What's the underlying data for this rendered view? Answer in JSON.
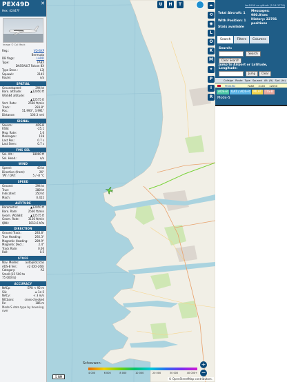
{
  "aircraft": {
    "callsign": "PEX49D",
    "hex_label": "Hex:",
    "hex": "42447F",
    "photo_caption": "Image © Col Mack",
    "close_icon": "close-icon",
    "general": [
      {
        "label": "Reg.:",
        "value": "VQ-BXP",
        "link": true
      },
      {
        "label": "",
        "value": "Bermuda",
        "link": false
      },
      {
        "label": "DB flags:",
        "value": "LADD",
        "link": true
      },
      {
        "label": "Type:",
        "value": "FA8X",
        "link": false
      },
      {
        "label": "",
        "value": "DASSAULT Falcon 8X",
        "link": false
      },
      {
        "label": "Type Desc.:",
        "value": "L3J",
        "link": false
      },
      {
        "label": "Squawk:",
        "value": "2145",
        "link": false
      },
      {
        "label": "Route:",
        "value": "n/a",
        "link": false
      }
    ],
    "sections": [
      {
        "title": "SPATIAL",
        "rows": [
          {
            "label": "Groundspeed:",
            "value": "294 kt"
          },
          {
            "label": "Baro. altitude:",
            "value": "▲12050 ft"
          },
          {
            "label": "WGS84 altitude:",
            "value": ""
          },
          {
            "label": "",
            "value": "▲12575 ft"
          },
          {
            "label": "Vert. Rate:",
            "value": "2560 ft/min"
          },
          {
            "label": "Track:",
            "value": "283.8°"
          },
          {
            "label": "Pos.:",
            "value": "51.993°, 3.991°"
          },
          {
            "label": "Distance:",
            "value": "100.3 nmi"
          }
        ]
      },
      {
        "title": "SIGNAL",
        "rows": [
          {
            "label": "Source:",
            "value": "ADS-B"
          },
          {
            "label": "RSSI:",
            "value": "-25.1"
          },
          {
            "label": "Msg. Rate:",
            "value": "1.6"
          },
          {
            "label": "Messages:",
            "value": "158"
          },
          {
            "label": "Last Pos.:",
            "value": "0.7 s"
          },
          {
            "label": "Last Seen:",
            "value": "0.7 s"
          }
        ]
      },
      {
        "title": "FMS SEL",
        "rows": [
          {
            "label": "Sel. Alt.:",
            "value": "18000 ft"
          },
          {
            "label": "Sel. Head.:",
            "value": "n/a"
          }
        ]
      },
      {
        "title": "WIND",
        "rows": [
          {
            "label": "Speed:",
            "value": "43 kt"
          },
          {
            "label": "Direction (from):",
            "value": "26°"
          },
          {
            "label": "TAT / OAT:",
            "value": "5 / -8 °C"
          }
        ]
      },
      {
        "title": "SPEED",
        "rows": [
          {
            "label": "Ground:",
            "value": "294 kt"
          },
          {
            "label": "True:",
            "value": "288 kt"
          },
          {
            "label": "Indicated:",
            "value": "250 kt"
          },
          {
            "label": "Mach:",
            "value": "0.452"
          }
        ]
      },
      {
        "title": "ALTITUDE",
        "rows": [
          {
            "label": "Barometric:",
            "value": "▲12050 ft"
          },
          {
            "label": "Baro. Rate:",
            "value": "2560 ft/min"
          },
          {
            "label": "Geom. WGS84:",
            "value": "▲12575 ft"
          },
          {
            "label": "Geom. Rate:",
            "value": "3136 ft/min"
          },
          {
            "label": "QNH:",
            "value": "1013.6 hPa"
          }
        ]
      },
      {
        "title": "DIRECTION",
        "rows": [
          {
            "label": "Ground Track:",
            "value": "283.8°"
          },
          {
            "label": "True Heading:",
            "value": "292.3°"
          },
          {
            "label": "Magnetic Heading:",
            "value": "289.9°"
          },
          {
            "label": "Magnetic Decl.:",
            "value": "2.4°"
          },
          {
            "label": "Track Rate:",
            "value": "0.06"
          },
          {
            "label": "Roll:",
            "value": "0.5"
          }
        ]
      },
      {
        "title": "STUFF",
        "rows": [
          {
            "label": "Nav. Modes:",
            "value": "autopilot,tcas"
          },
          {
            "label": "ADS-B Ver.:",
            "value": "v2 (DO-260)"
          },
          {
            "label": "Category:",
            "value": "A2"
          },
          {
            "label": "Small (15 500 to",
            "value": ""
          },
          {
            "label": "75 000 lb)",
            "value": ""
          }
        ]
      },
      {
        "title": "ACCURACY",
        "rows": [
          {
            "label": "NACp:",
            "value": "EPU < 92 m"
          },
          {
            "label": "SIL:",
            "value": "≤ 1e-5"
          },
          {
            "label": "NACv:",
            "value": "< 3 m/s"
          },
          {
            "label": "NICbaro:",
            "value": "cross-checked"
          },
          {
            "label": "Rc:",
            "value": "186 m"
          }
        ]
      }
    ],
    "footer_note": "Mode S data type by hovering over"
  },
  "map": {
    "top_buttons": [
      "U",
      "H",
      "T"
    ],
    "side_buttons": [
      "L",
      "O",
      "K",
      "M",
      "P",
      "I",
      "R"
    ],
    "scale_label": "5 NM",
    "place_label": "Schouwen-",
    "attribution": "© OpenStreetMap contributors.",
    "alt_labels": [
      "4 000",
      "6 000",
      "8 000",
      "10 000",
      "20 000",
      "30 000",
      "40 000+"
    ],
    "zoom_in": "+",
    "zoom_out": "−"
  },
  "panel": {
    "github_link": "tar1090 on github (3.14.1779)",
    "total_label": "Total Aircraft: 1",
    "messages_label": "Messages:",
    "messages_value": "980.8/sec",
    "with_position": "With Position: 1",
    "history_label": "History: 22781",
    "history_sub": "positions",
    "stats_label": "Stats available",
    "tabs": [
      "Search",
      "Filters",
      "Columns"
    ],
    "search_label": "Search:",
    "search_button": "Search",
    "clear_search": "Clear Search",
    "jump_label": "Jump to Airport or Latitude, Longitude:",
    "jump_button": "Jump",
    "clear_button": "Clear",
    "columns": [
      "Callsign",
      "Route",
      "Type",
      "Squawk",
      "Alt. (ft)",
      "Spd. (kt)"
    ],
    "row": {
      "callsign": "PEX49D",
      "type": "FA8X",
      "squawk": "2145",
      "alt": "12050"
    },
    "badges": [
      {
        "text": "ADS-B",
        "color": "#4cc8a6"
      },
      {
        "text": "UAT / ADS-R",
        "color": "#5ab4e6"
      },
      {
        "text": "MLAT",
        "color": "#f0d44a"
      },
      {
        "text": "TIS-B",
        "color": "#e7a79a"
      }
    ],
    "modes_label": "Mode-S"
  }
}
